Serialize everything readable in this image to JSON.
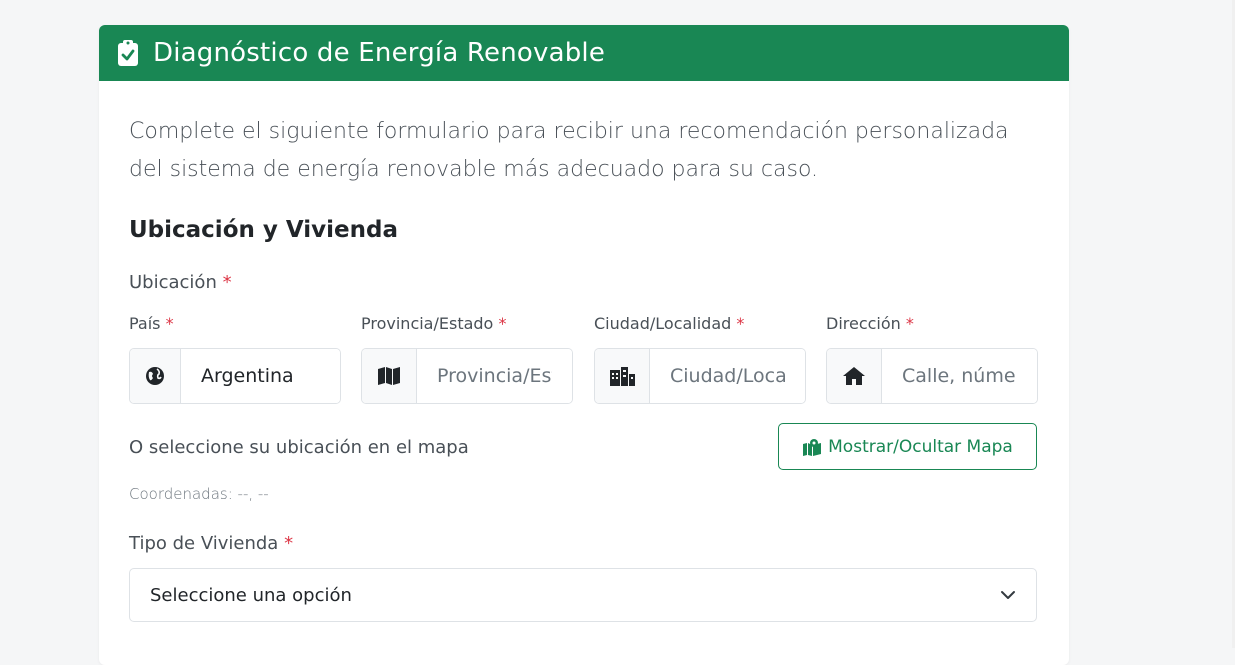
{
  "header": {
    "title": "Diagnóstico de Energía Renovable",
    "icon": "clipboard-check-icon"
  },
  "intro": "Complete el siguiente formulario para recibir una recomendación personalizada del sistema de energía renovable más adecuado para su caso.",
  "section": {
    "title": "Ubicación y Vivienda"
  },
  "ubicacion": {
    "label": "Ubicación",
    "required": "*",
    "fields": [
      {
        "label": "País",
        "value": "Argentina",
        "placeholder": "",
        "icon": "globe-icon"
      },
      {
        "label": "Provincia/Estado",
        "value": "",
        "placeholder": "Provincia/Estado",
        "icon": "map-icon"
      },
      {
        "label": "Ciudad/Localidad",
        "value": "",
        "placeholder": "Ciudad/Localidad",
        "icon": "city-icon"
      },
      {
        "label": "Dirección",
        "value": "",
        "placeholder": "Calle, número",
        "icon": "home-icon"
      }
    ]
  },
  "map": {
    "text": "O seleccione su ubicación en el mapa",
    "button_label": "Mostrar/Ocultar Mapa",
    "button_icon": "map-marked-icon",
    "coords": "Coordenadas: --, --"
  },
  "tipo": {
    "label": "Tipo de Vivienda",
    "required": "*",
    "selected": "Seleccione una opción"
  },
  "colors": {
    "primary": "#198754",
    "required": "#dc3545"
  }
}
